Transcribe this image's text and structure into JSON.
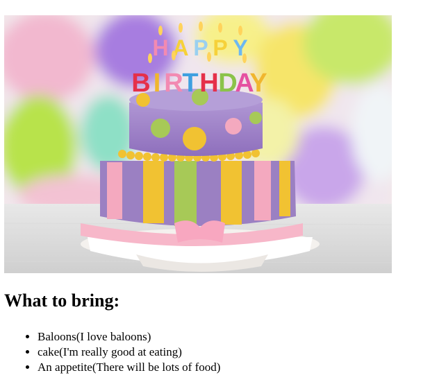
{
  "hero_image": {
    "candle_letters": [
      "H",
      "A",
      "P",
      "P",
      "Y",
      "B",
      "I",
      "R",
      "T",
      "H",
      "D",
      "A",
      "Y"
    ],
    "colors": {
      "frosting_purple": "#9b80c2",
      "stripe_yellow": "#f1c232",
      "stripe_green": "#a7c957",
      "stripe_pink": "#f4a9bf",
      "ribbon_pink": "#f7b7c9"
    }
  },
  "section": {
    "title": "What to bring:",
    "items": [
      {
        "label": "Baloons(I love baloons)"
      },
      {
        "label": "cake(I'm really good at eating)"
      },
      {
        "label": "An appetite(There will be lots of food)"
      }
    ]
  }
}
